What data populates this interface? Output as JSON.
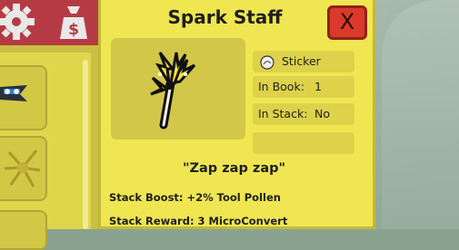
{
  "item": {
    "title": "Spark Staff",
    "quote": "\"Zap zap zap\"",
    "stats": {
      "sticker_label": "Sticker",
      "in_book_label": "In Book:",
      "in_book_value": "1",
      "in_stack_label": "In Stack:",
      "in_stack_value": "No"
    },
    "stack_boost": "Stack Boost: +2% Tool Pollen",
    "stack_reward": "Stack Reward: 3 MicroConvert"
  },
  "close_label": "X",
  "icons": [
    "gear-icon",
    "money-bag-icon",
    "spark-staff-icon",
    "sticker-icon",
    "close-icon"
  ]
}
